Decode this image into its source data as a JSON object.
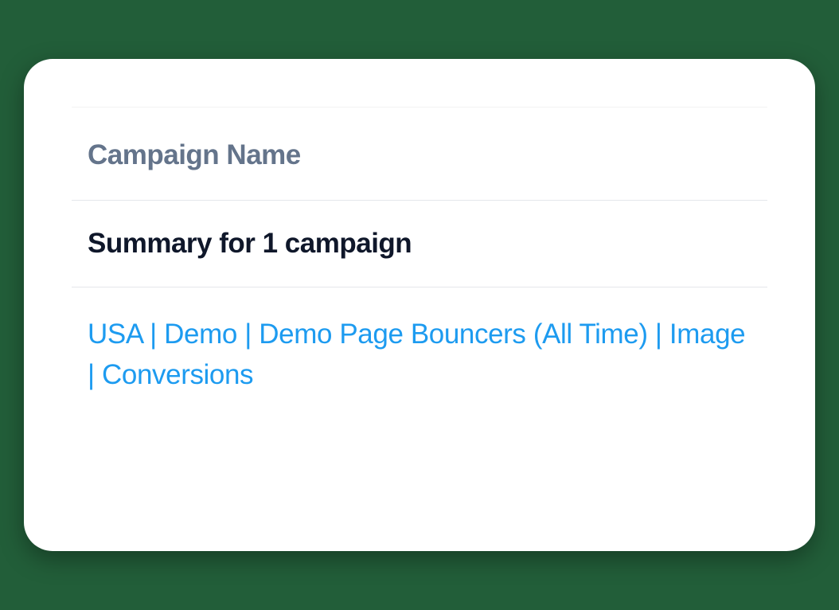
{
  "table": {
    "column_header": "Campaign Name",
    "summary_text": "Summary for 1 campaign",
    "campaign_name": "USA | Demo | Demo Page Bouncers (All Time) | Image | Conversions"
  }
}
